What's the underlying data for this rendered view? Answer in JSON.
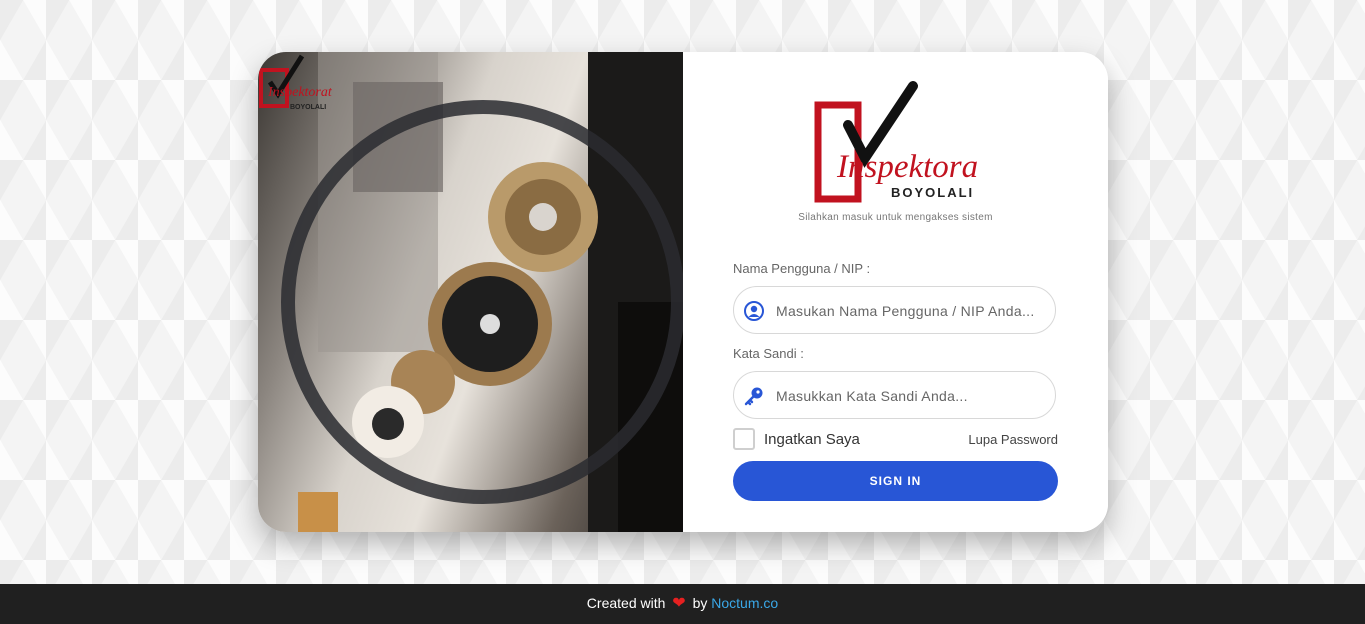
{
  "brand": {
    "logo_word": "Inspektorat",
    "logo_sub": "BOYOLALI"
  },
  "login": {
    "subtitle": "Silahkan masuk untuk mengakses sistem",
    "username_label": "Nama Pengguna / NIP :",
    "username_placeholder": "Masukan Nama Pengguna / NIP Anda...",
    "password_label": "Kata Sandi :",
    "password_placeholder": "Masukkan Kata Sandi Anda...",
    "remember_label": "Ingatkan Saya",
    "forgot_label": "Lupa Password",
    "signin_label": "SIGN IN",
    "accent_color": "#2856d6"
  },
  "footer": {
    "prefix": "Created with",
    "by": "by",
    "brand": "Noctum.co",
    "heart_icon": "heart-icon"
  }
}
